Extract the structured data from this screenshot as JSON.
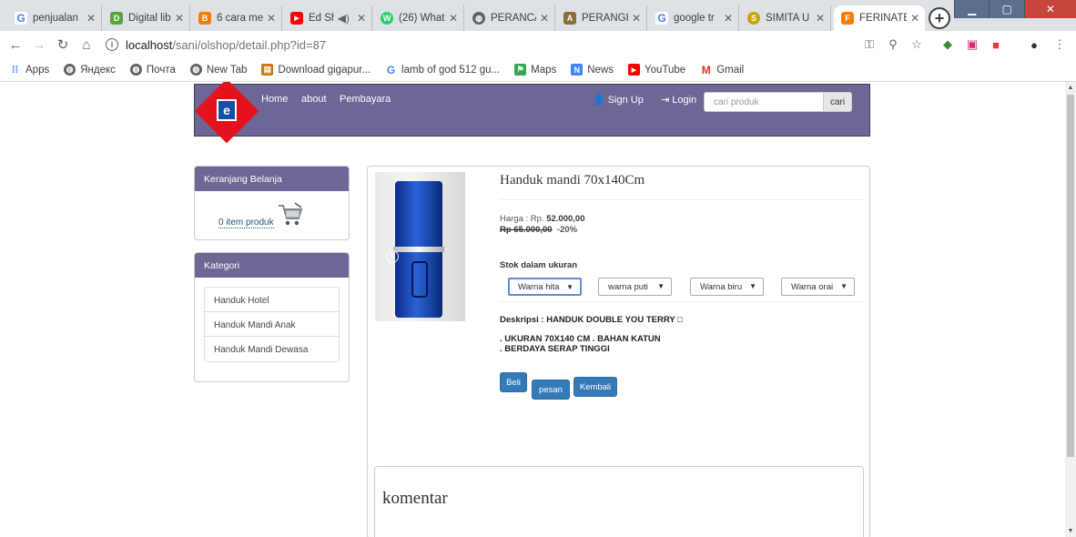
{
  "browser": {
    "tabs": [
      {
        "label": "penjualan",
        "favicon": "G",
        "color": "#4285f4"
      },
      {
        "label": "Digital lib",
        "favicon": "D",
        "color": "#5aa43a"
      },
      {
        "label": "6 cara me",
        "favicon": "B",
        "color": "#f57d00"
      },
      {
        "label": "Ed Sh",
        "favicon": "▶",
        "color": "#ff0000"
      },
      {
        "label": "(26) What",
        "favicon": "W",
        "color": "#25d366"
      },
      {
        "label": "PERANCA",
        "favicon": "◍",
        "color": "#5f6368"
      },
      {
        "label": "PERANGK",
        "favicon": "A",
        "color": "#8a6d3b"
      },
      {
        "label": "google tr",
        "favicon": "G",
        "color": "#4285f4"
      },
      {
        "label": "SIMITA U",
        "favicon": "S",
        "color": "#c8a400"
      },
      {
        "label": "FERINATE",
        "favicon": "F",
        "color": "#f57d00"
      }
    ],
    "url_host": "localhost",
    "url_path": "/sani/olshop/detail.php?id=87",
    "bookmarks": [
      {
        "label": "Apps",
        "icon": "apps-icon",
        "color": "#4285f4"
      },
      {
        "label": "Яндекс",
        "icon": "globe-icon",
        "color": "#5f6368"
      },
      {
        "label": "Почта",
        "icon": "globe-icon",
        "color": "#5f6368"
      },
      {
        "label": "New Tab",
        "icon": "globe-icon",
        "color": "#5f6368"
      },
      {
        "label": "Download gigapur...",
        "icon": "download-icon",
        "color": "#c47a12"
      },
      {
        "label": "lamb of god 512 gu...",
        "icon": "google-icon",
        "color": "#4285f4"
      },
      {
        "label": "Maps",
        "icon": "maps-icon",
        "color": "#34a853"
      },
      {
        "label": "News",
        "icon": "news-icon",
        "color": "#4285f4"
      },
      {
        "label": "YouTube",
        "icon": "youtube-icon",
        "color": "#ff0000"
      },
      {
        "label": "Gmail",
        "icon": "gmail-icon",
        "color": "#d93025"
      }
    ]
  },
  "nav": {
    "home": "Home",
    "about": "about",
    "pembayaran": "Pembayara",
    "signup": "Sign Up",
    "login": "Login",
    "search_placeholder": "cari produk",
    "search_button": "cari",
    "accent": "#6e6695"
  },
  "cart": {
    "title": "Keranjang Belanja",
    "link": "0 item produk"
  },
  "categories": {
    "title": "Kategori",
    "items": [
      "Handuk Hotel",
      "Handuk Mandi Anak",
      "Handuk Mandi Dewasa"
    ]
  },
  "product": {
    "name": "Handuk mandi 70x140Cm",
    "price_label": "Harga : Rp.",
    "price": "52.000,00",
    "old_price": "Rp 65.000,00",
    "discount": "-20%",
    "stock_label": "Stok dalam ukuran",
    "variants": [
      "Warna hita",
      "warna puti",
      "Warna biru",
      "Warna orai"
    ],
    "description_title": "Deskripsi : HANDUK DOUBLE YOU TERRY □",
    "description_lines": [
      ". UKURAN 70X140 CM . BAHAN KATUN",
      ". BERDAYA SERAP TINGGI"
    ],
    "buttons": {
      "beli": "Beli",
      "pesan": "pesan",
      "kembali": "Kembali"
    },
    "comment_title": "komentar"
  }
}
